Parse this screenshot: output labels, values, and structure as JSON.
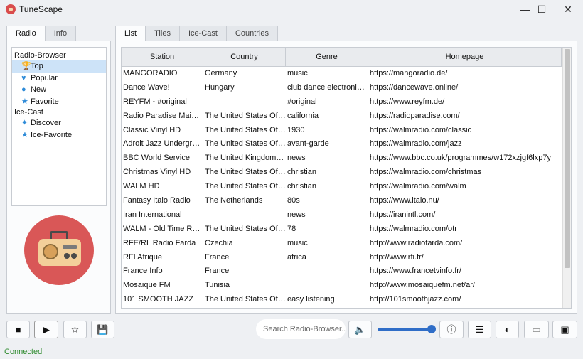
{
  "app": {
    "title": "TuneScape"
  },
  "window_controls": {
    "minimize": "—",
    "maximize": "☐",
    "close": "✕"
  },
  "left_tabs": [
    "Radio",
    "Info"
  ],
  "tree": {
    "groups": [
      {
        "label": "Radio-Browser",
        "items": [
          {
            "label": "Top",
            "icon": "trophy-icon"
          },
          {
            "label": "Popular",
            "icon": "heart-icon"
          },
          {
            "label": "New",
            "icon": "info-icon"
          },
          {
            "label": "Favorite",
            "icon": "star-icon"
          }
        ]
      },
      {
        "label": "Ice-Cast",
        "items": [
          {
            "label": "Discover",
            "icon": "satellite-icon"
          },
          {
            "label": "Ice-Favorite",
            "icon": "star-icon"
          }
        ]
      }
    ],
    "selected": "Top"
  },
  "right_tabs": [
    "List",
    "Tiles",
    "Ice-Cast",
    "Countries"
  ],
  "table": {
    "columns": [
      "Station",
      "Country",
      "Genre",
      "Homepage"
    ],
    "rows": [
      [
        "MANGORADIO",
        "Germany",
        "music",
        "https://mangoradio.de/"
      ],
      [
        "Dance Wave!",
        "Hungary",
        "club dance electronic h...",
        "https://dancewave.online/"
      ],
      [
        "REYFM - #original",
        "",
        "#original",
        "https://www.reyfm.de/"
      ],
      [
        "Radio Paradise Main Mi...",
        "The United States Of A...",
        "california",
        "https://radioparadise.com/"
      ],
      [
        "Classic Vinyl HD",
        "The United States Of A...",
        "1930",
        "https://walmradio.com/classic"
      ],
      [
        "Adroit Jazz Underground",
        "The United States Of A...",
        "avant-garde",
        "https://walmradio.com/jazz"
      ],
      [
        "BBC World Service",
        "The United Kingdom Of...",
        "news",
        "https://www.bbc.co.uk/programmes/w172xzjgf6lxp7y"
      ],
      [
        "Christmas Vinyl HD",
        "The United States Of A...",
        "christian",
        "https://walmradio.com/christmas"
      ],
      [
        "WALM HD",
        "The United States Of A...",
        "christian",
        "https://walmradio.com/walm"
      ],
      [
        "Fantasy Italo Radio",
        "The Netherlands",
        "80s",
        "https://www.italo.nu/"
      ],
      [
        "Iran International",
        "",
        "news",
        "https://iranintl.com/"
      ],
      [
        "WALM - Old Time Radio",
        "The United States Of A...",
        "78",
        "https://walmradio.com/otr"
      ],
      [
        "RFE/RL Radio Farda",
        "Czechia",
        "music",
        "http://www.radiofarda.com/"
      ],
      [
        "RFI Afrique",
        "France",
        "africa",
        "http://www.rfi.fr/"
      ],
      [
        "France Info",
        "France",
        "",
        "https://www.francetvinfo.fr/"
      ],
      [
        "Mosaique FM",
        "Tunisia",
        "",
        "http://www.mosaiquefm.net/ar/"
      ],
      [
        "101 SMOOTH JAZZ",
        "The United States Of A...",
        "easy listening",
        "http://101smoothjazz.com/"
      ]
    ]
  },
  "controls": {
    "stop": "■",
    "play": "▶",
    "favorite": "☆",
    "save": "💾",
    "search_placeholder": "Search Radio-Browser...",
    "mute": "🔈",
    "volume_fraction": 1.0,
    "info": "ⓘ",
    "menu": "☰",
    "theme": "◐",
    "mini_player": "▭",
    "picture_in_picture": "▣"
  },
  "status": {
    "text": "Connected",
    "color": "#2d8a2d"
  }
}
